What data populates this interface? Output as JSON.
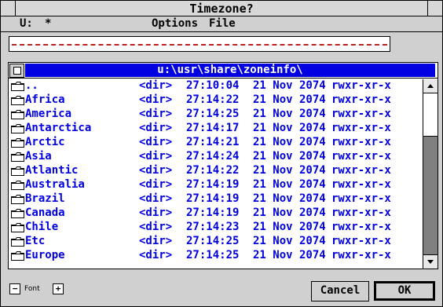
{
  "window": {
    "title": "Timezone?"
  },
  "menu": {
    "drive": "U:",
    "wildcard": "*",
    "options": "Options",
    "file": "File"
  },
  "filename_input": {
    "value": ""
  },
  "path": "u:\\usr\\share\\zoneinfo\\",
  "files": [
    {
      "name": "..",
      "size": "<dir>",
      "time": "27:10:04",
      "date": "21 Nov 2074",
      "attr": "rwxr-xr-x"
    },
    {
      "name": "Africa",
      "size": "<dir>",
      "time": "27:14:22",
      "date": "21 Nov 2074",
      "attr": "rwxr-xr-x"
    },
    {
      "name": "America",
      "size": "<dir>",
      "time": "27:14:25",
      "date": "21 Nov 2074",
      "attr": "rwxr-xr-x"
    },
    {
      "name": "Antarctica",
      "size": "<dir>",
      "time": "27:14:17",
      "date": "21 Nov 2074",
      "attr": "rwxr-xr-x"
    },
    {
      "name": "Arctic",
      "size": "<dir>",
      "time": "27:14:21",
      "date": "21 Nov 2074",
      "attr": "rwxr-xr-x"
    },
    {
      "name": "Asia",
      "size": "<dir>",
      "time": "27:14:24",
      "date": "21 Nov 2074",
      "attr": "rwxr-xr-x"
    },
    {
      "name": "Atlantic",
      "size": "<dir>",
      "time": "27:14:22",
      "date": "21 Nov 2074",
      "attr": "rwxr-xr-x"
    },
    {
      "name": "Australia",
      "size": "<dir>",
      "time": "27:14:19",
      "date": "21 Nov 2074",
      "attr": "rwxr-xr-x"
    },
    {
      "name": "Brazil",
      "size": "<dir>",
      "time": "27:14:19",
      "date": "21 Nov 2074",
      "attr": "rwxr-xr-x"
    },
    {
      "name": "Canada",
      "size": "<dir>",
      "time": "27:14:19",
      "date": "21 Nov 2074",
      "attr": "rwxr-xr-x"
    },
    {
      "name": "Chile",
      "size": "<dir>",
      "time": "27:14:23",
      "date": "21 Nov 2074",
      "attr": "rwxr-xr-x"
    },
    {
      "name": "Etc",
      "size": "<dir>",
      "time": "27:14:25",
      "date": "21 Nov 2074",
      "attr": "rwxr-xr-x"
    },
    {
      "name": "Europe",
      "size": "<dir>",
      "time": "27:14:25",
      "date": "21 Nov 2074",
      "attr": "rwxr-xr-x"
    }
  ],
  "font_control": {
    "minus": "−",
    "label": "Font",
    "plus": "+"
  },
  "buttons": {
    "cancel": "Cancel",
    "ok": "OK"
  },
  "colors": {
    "accent": "#0000e0",
    "background": "#d0d0d0"
  }
}
